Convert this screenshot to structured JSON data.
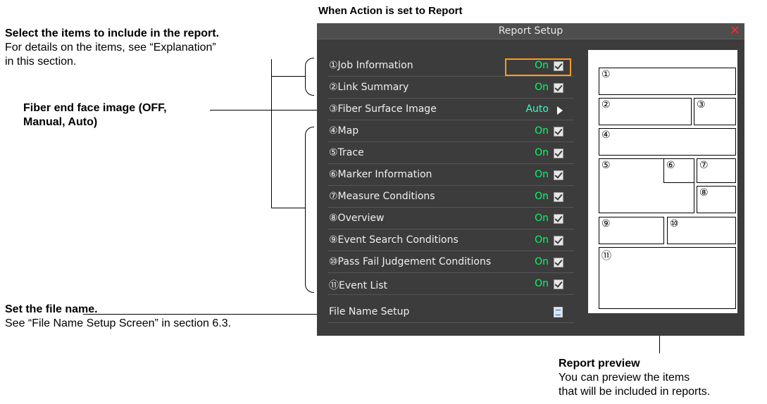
{
  "caption": "When Action is set to Report",
  "annotations": {
    "select_items_title": "Select the items to include in the report.",
    "select_items_line1": "For details on the items, see “Explanation”",
    "select_items_line2": "in this section.",
    "fiber_title_line1": "Fiber end face image (OFF,",
    "fiber_title_line2": "Manual, Auto)",
    "filename_title": "Set the file name.",
    "filename_desc": "See “File Name Setup Screen” in section 6.3.",
    "preview_title": "Report preview",
    "preview_desc_line1": "You can preview the items",
    "preview_desc_line2": "that will be included in reports."
  },
  "window": {
    "title": "Report Setup",
    "close_icon": "close-icon"
  },
  "items": [
    {
      "label": "①Job Information",
      "value": "On",
      "control": "checkbox"
    },
    {
      "label": "②Link Summary",
      "value": "On",
      "control": "checkbox"
    },
    {
      "label": "③Fiber Surface Image",
      "value": "Auto",
      "control": "arrow"
    },
    {
      "label": "④Map",
      "value": "On",
      "control": "checkbox"
    },
    {
      "label": "⑤Trace",
      "value": "On",
      "control": "checkbox"
    },
    {
      "label": "⑥Marker Information",
      "value": "On",
      "control": "checkbox"
    },
    {
      "label": "⑦Measure Conditions",
      "value": "On",
      "control": "checkbox"
    },
    {
      "label": "⑧Overview",
      "value": "On",
      "control": "checkbox"
    },
    {
      "label": "⑨Event Search Conditions",
      "value": "On",
      "control": "checkbox"
    },
    {
      "label": "⑩Pass Fail Judgement Conditions",
      "value": "On",
      "control": "checkbox"
    },
    {
      "label": "⑪Event List",
      "value": "On",
      "control": "checkbox"
    }
  ],
  "file_name_setup": {
    "label": "File Name Setup",
    "icon": "file-name-icon"
  },
  "preview": [
    "①",
    "②",
    "③",
    "④",
    "⑤",
    "⑥",
    "⑦",
    "⑧",
    "⑨",
    "⑩",
    "⑪"
  ],
  "colors": {
    "screen_bg": "#3c3c3c",
    "value_on": "#00ff66",
    "highlight": "#ff9a1a",
    "close": "#ff2a2a"
  }
}
